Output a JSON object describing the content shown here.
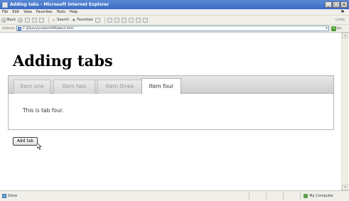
{
  "window": {
    "title": "Adding tabs - Microsoft Internet Explorer",
    "buttons": {
      "minimize": "_",
      "maximize": "□",
      "close": "×"
    }
  },
  "menu": [
    "File",
    "Edit",
    "View",
    "Favorites",
    "Tools",
    "Help"
  ],
  "toolbar": {
    "back": "Back",
    "search": "Search",
    "favorites": "Favorites",
    "links": "Links"
  },
  "address": {
    "label": "Address",
    "url": "C:\\jQuery\\code\\ch09\\tabs2.html",
    "go": "Go"
  },
  "page": {
    "title": "Adding tabs",
    "tabs": [
      "Item one",
      "Item two",
      "Item three",
      "Item four"
    ],
    "active_tab_index": 3,
    "panel_text": "This is tab four.",
    "add_button": "Add tab"
  },
  "status": {
    "text": "Done",
    "zone": "My Computer"
  },
  "colors": {
    "titlebar": "#3a6bc4",
    "chrome": "#f0efe9",
    "tab_strip": "#d6d6d6"
  }
}
